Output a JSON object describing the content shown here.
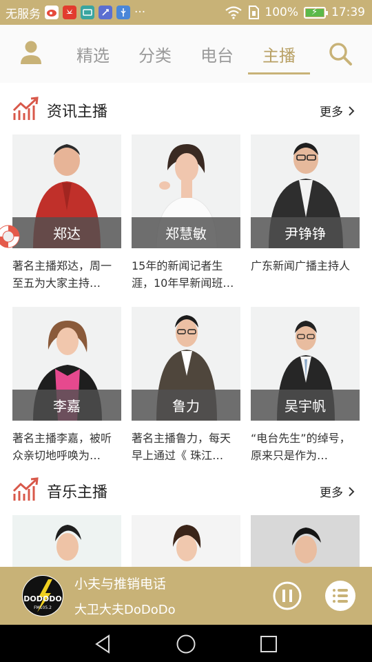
{
  "status_bar": {
    "carrier": "无服务",
    "app_icons": [
      "weibo-icon",
      "huawei-icon",
      "wallet-icon",
      "usb-tool-icon",
      "usb-icon"
    ],
    "more": "···",
    "battery": "100%",
    "battery_level": 1.0,
    "time": "17:39"
  },
  "nav": {
    "tabs": [
      {
        "label": "精选",
        "active": false
      },
      {
        "label": "分类",
        "active": false
      },
      {
        "label": "电台",
        "active": false
      },
      {
        "label": "主播",
        "active": true
      }
    ]
  },
  "sections": [
    {
      "title": "资讯主播",
      "more": "更多",
      "hosts": [
        {
          "name": "郑达",
          "desc": "著名主播郑达，周一至五为大家主持…"
        },
        {
          "name": "郑慧敏",
          "desc": "15年的新闻记者生涯，10年早新闻班…"
        },
        {
          "name": "尹铮铮",
          "desc": "广东新闻广播主持人"
        },
        {
          "name": "李嘉",
          "desc": "著名主播李嘉，被听众亲切地呼唤为…"
        },
        {
          "name": "鲁力",
          "desc": "著名主播鲁力，每天早上通过《 珠江…"
        },
        {
          "name": "吴宇帆",
          "desc": "“电台先生”的绰号，原来只是作为…"
        }
      ]
    },
    {
      "title": "音乐主播",
      "more": "更多",
      "hosts": [
        {
          "name": "",
          "desc": ""
        },
        {
          "name": "",
          "desc": ""
        },
        {
          "name": "",
          "desc": ""
        }
      ]
    }
  ],
  "player": {
    "logo_text": "DODODO",
    "logo_sub": "FM105.2",
    "title": "小夫与推销电话",
    "subtitle": "大卫大夫DoDoDo"
  },
  "colors": {
    "accent": "#c8b277",
    "active_tab": "#b8a064",
    "section_icon": "#d8584a",
    "name_band": "#505050"
  }
}
